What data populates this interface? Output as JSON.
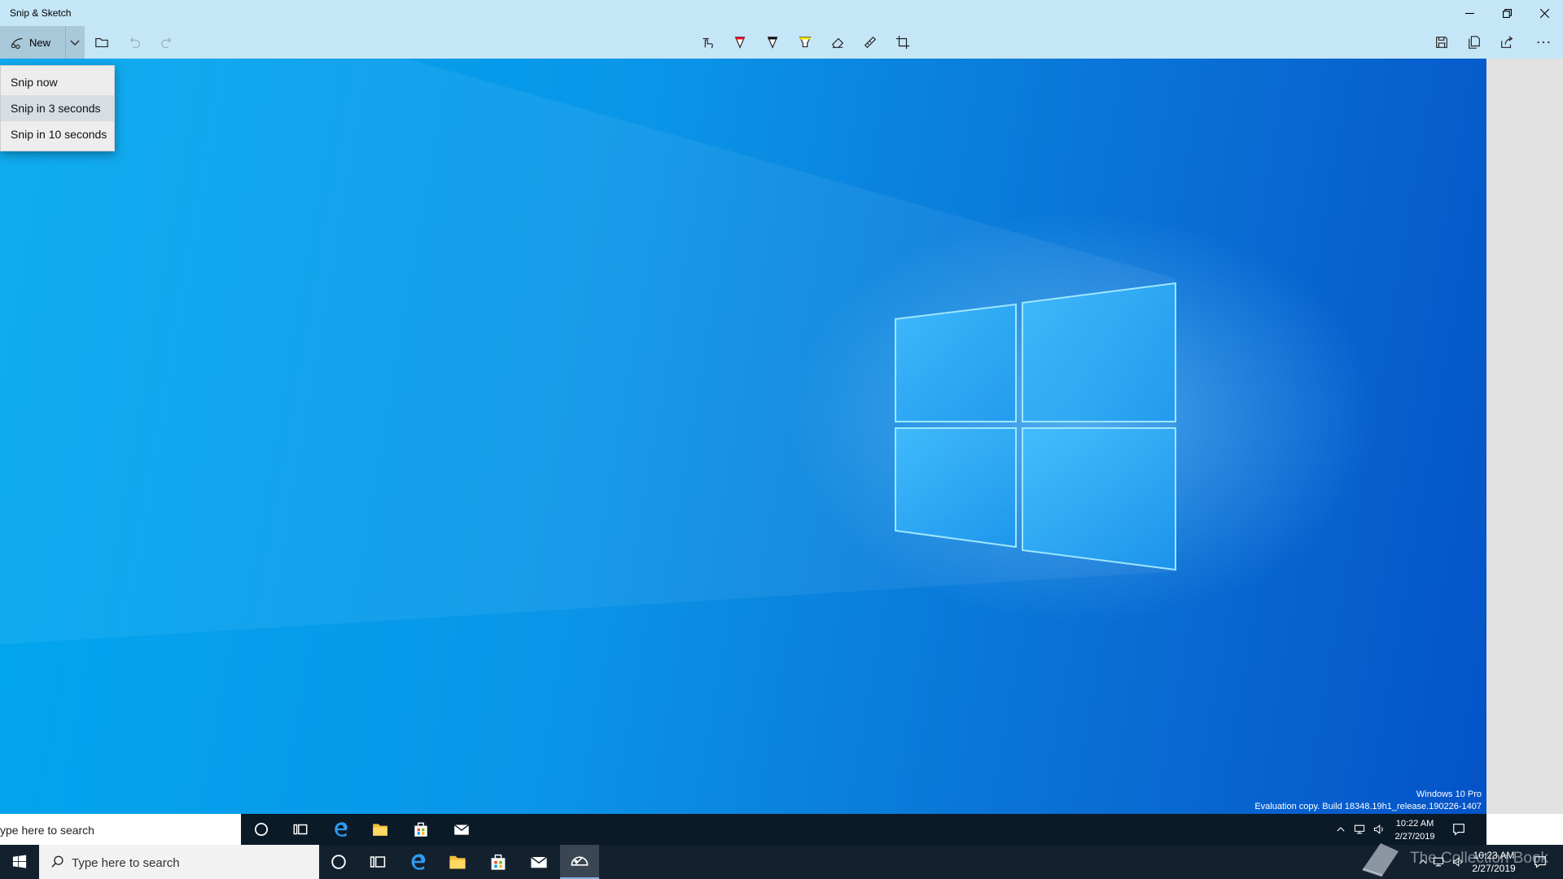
{
  "window": {
    "title": "Snip & Sketch",
    "minimize_icon": "minimize-icon",
    "restore_icon": "restore-icon",
    "close_icon": "close-icon"
  },
  "toolbar": {
    "new_label": "New",
    "tools": [
      "touch-writing",
      "ballpoint-pen",
      "pencil",
      "highlighter",
      "eraser",
      "ruler",
      "crop"
    ],
    "actions": [
      "save",
      "copy",
      "share",
      "see-more"
    ]
  },
  "new_menu": {
    "items": [
      {
        "label": "Snip now"
      },
      {
        "label": "Snip in 3 seconds"
      },
      {
        "label": "Snip in 10 seconds"
      }
    ]
  },
  "captured_screen": {
    "watermark_line1": "Windows 10 Pro",
    "watermark_line2": "Evaluation copy. Build 18348.19h1_release.190226-1407",
    "search_text": "ype here to search",
    "clock_time": "10:22 AM",
    "clock_date": "2/27/2019"
  },
  "taskbar": {
    "search_placeholder": "Type here to search",
    "clock_time": "10:23 AM",
    "clock_date": "2/27/2019"
  },
  "overlay_watermark": "The Collection Book",
  "colors": {
    "titlebar": "#c5e6f7",
    "accent": "#0063b1",
    "taskbar": "#13202d"
  }
}
